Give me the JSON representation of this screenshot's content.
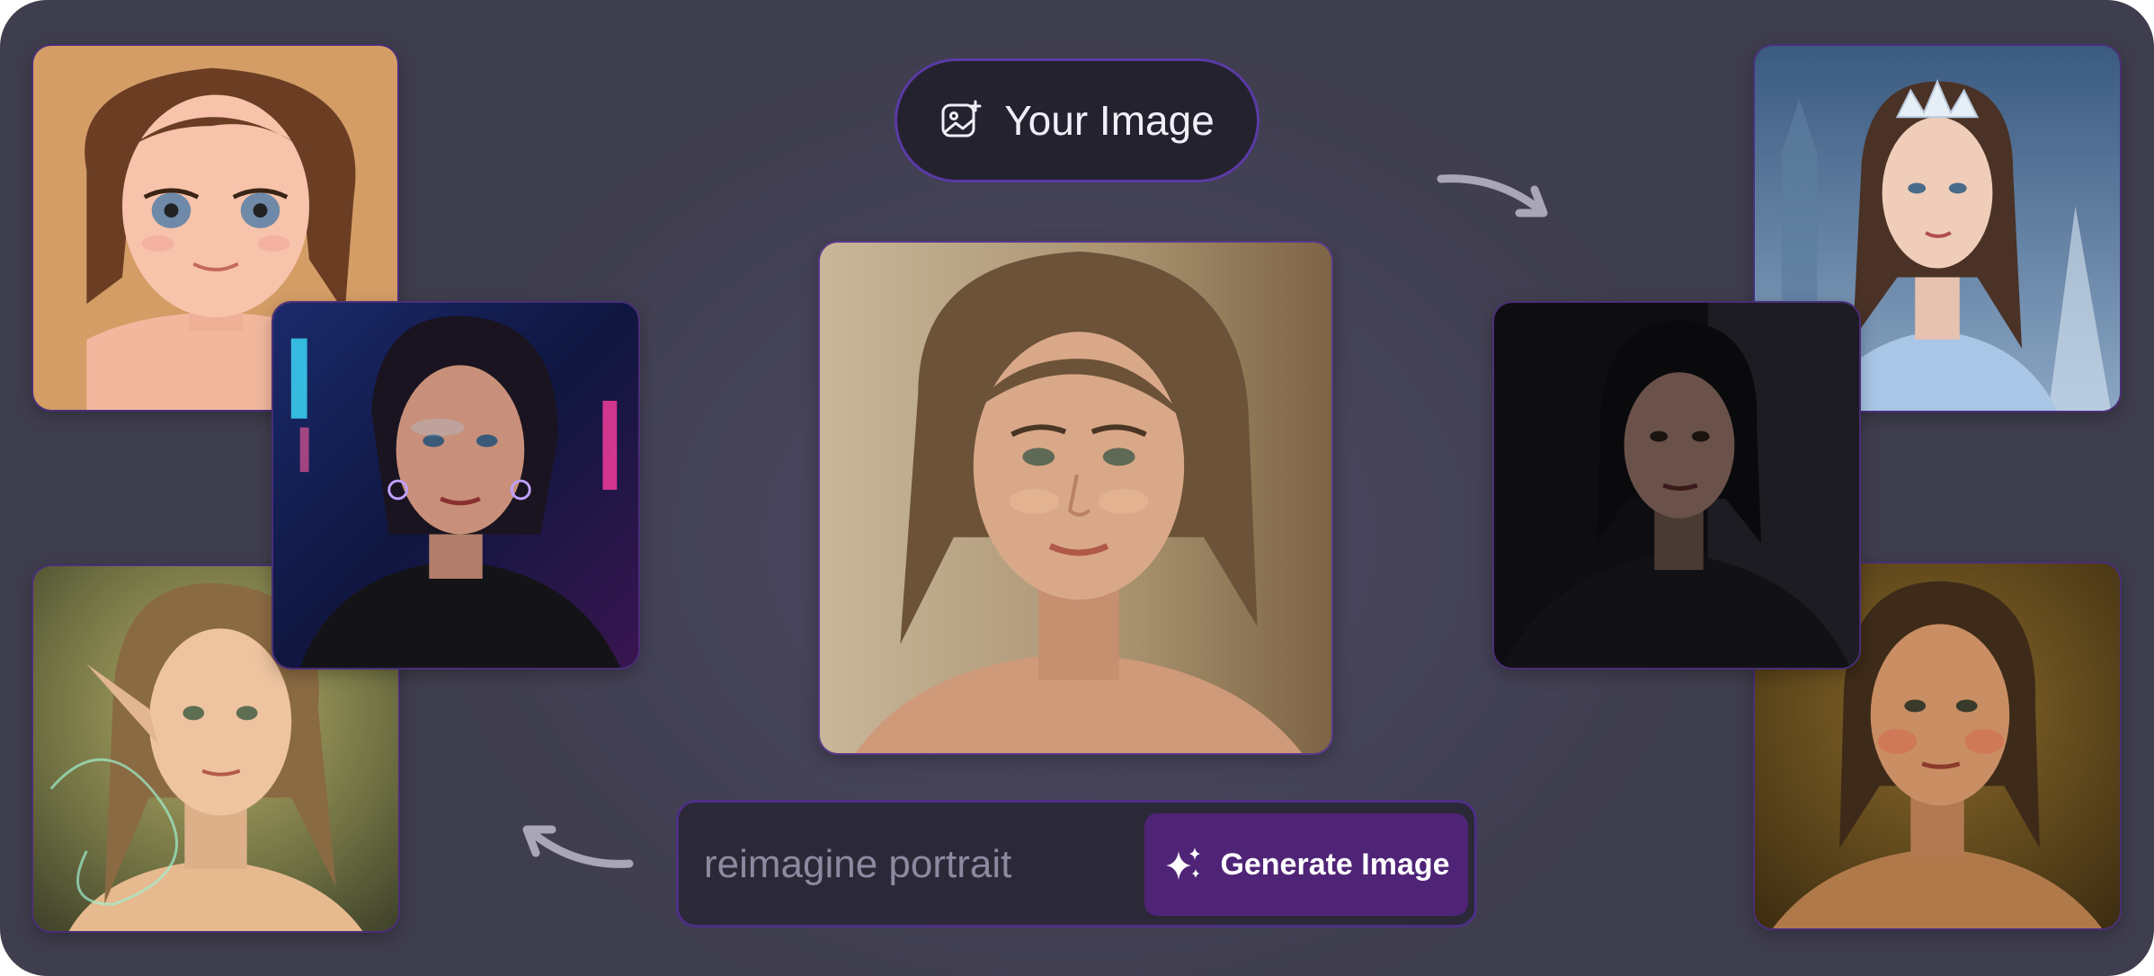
{
  "pill": {
    "label": "Your Image",
    "icon": "image-sparkle-icon"
  },
  "prompt": {
    "placeholder": "reimagine portrait",
    "button_label": "Generate Image",
    "button_icon": "sparkles-icon"
  },
  "images": [
    {
      "id": "anime",
      "style": "anime"
    },
    {
      "id": "cyberpunk",
      "style": "neon cyberpunk"
    },
    {
      "id": "elf",
      "style": "fantasy elf"
    },
    {
      "id": "original",
      "style": "original photo"
    },
    {
      "id": "ice-queen",
      "style": "ice queen"
    },
    {
      "id": "noir",
      "style": "dark noir"
    },
    {
      "id": "painted",
      "style": "oil painting"
    }
  ],
  "colors": {
    "background": "#45425a",
    "accent": "#4f2477",
    "border": "#5b3aa6",
    "pill_bg": "#25222f"
  }
}
